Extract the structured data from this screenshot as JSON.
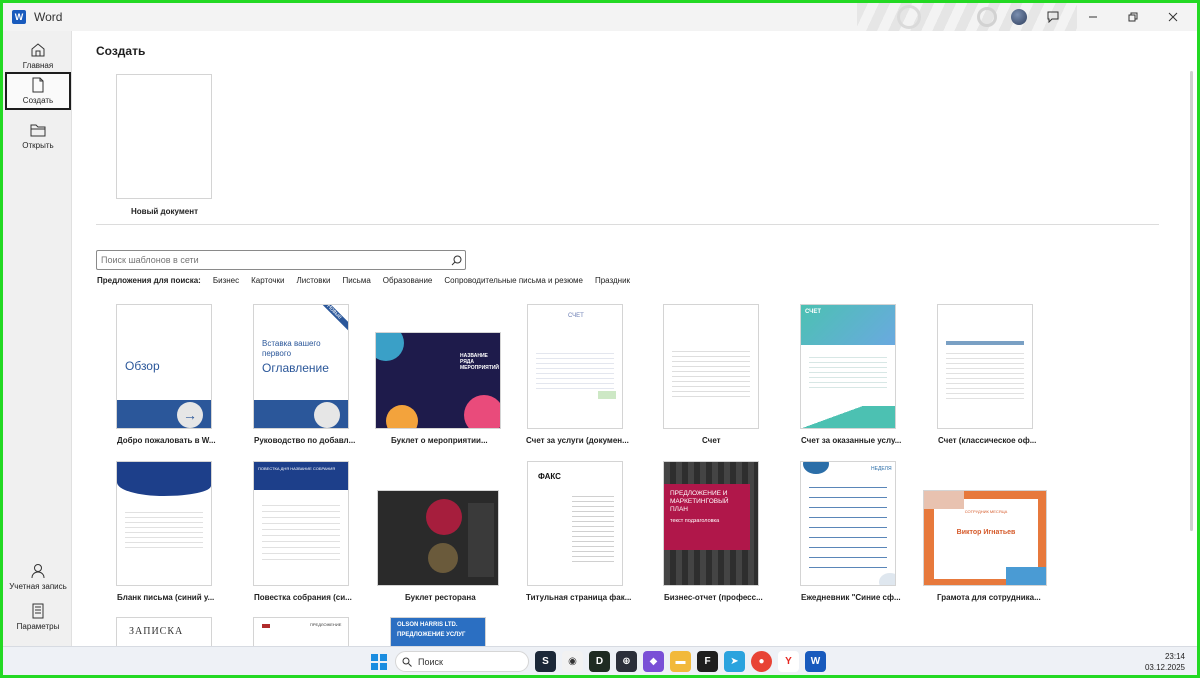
{
  "window": {
    "title": "Word"
  },
  "nav": {
    "home": "Главная",
    "new": "Создать",
    "open": "Открыть",
    "account": "Учетная запись",
    "options": "Параметры"
  },
  "main": {
    "title": "Создать",
    "blank_label": "Новый документ",
    "search_placeholder": "Поиск шаблонов в сети",
    "suggestions_label": "Предложения для поиска:",
    "suggestions": [
      "Бизнес",
      "Карточки",
      "Листовки",
      "Письма",
      "Образование",
      "Сопроводительные письма и резюме",
      "Праздник"
    ]
  },
  "templates": [
    {
      "caption": "Добро пожаловать в W...",
      "text": "Обзор"
    },
    {
      "caption": "Руководство по добавл...",
      "text": "Вставка вашего первого",
      "text2": "Оглавление",
      "badge": "Новые"
    },
    {
      "caption": "Буклет о мероприятии...",
      "text": "НАЗВАНИЕ РЯДА МЕРОПРИЯТИЙ"
    },
    {
      "caption": "Счет за услуги (докумен...",
      "text": "СЧЕТ"
    },
    {
      "caption": "Счет",
      "text": ""
    },
    {
      "caption": "Счет за оказанные услу...",
      "text": "СЧЕТ"
    },
    {
      "caption": "Счет (классическое оф...",
      "text": ""
    },
    {
      "caption": "Бланк письма (синий у...",
      "text": ""
    },
    {
      "caption": "Повестка собрания (си...",
      "text": "ПОВЕСТКА ДНЯ НАЗВАНИЕ СОБРАНИЯ"
    },
    {
      "caption": "Буклет ресторана",
      "text": ""
    },
    {
      "caption": "Титульная страница фак...",
      "text": "ФАКС"
    },
    {
      "caption": "Бизнес-отчет (професс...",
      "text": "ПРЕДЛОЖЕНИЕ И МАРКЕТИНГОВЫЙ ПЛАН",
      "text2": "текст подзаголовка"
    },
    {
      "caption": "Ежедневник \"Синие сф...",
      "text": "НЕДЕЛЯ"
    },
    {
      "caption": "Грамота для сотрудника...",
      "text": "Виктор Игнатьев",
      "text2": "СОТРУДНИК МЕСЯЦА"
    },
    {
      "caption": "",
      "text": "ЗАПИСКА"
    },
    {
      "caption": "",
      "text": "ПРЕДЛОЖЕНИЕ"
    },
    {
      "caption": "",
      "text": "OLSON HARRIS LTD.",
      "text2": "ПРЕДЛОЖЕНИЕ УСЛУГ"
    }
  ],
  "taskbar": {
    "search": "Поиск",
    "time": "23:14",
    "date": "03.12.2025"
  },
  "colors": {
    "accent": "#2b579a",
    "border": "#23d923"
  }
}
